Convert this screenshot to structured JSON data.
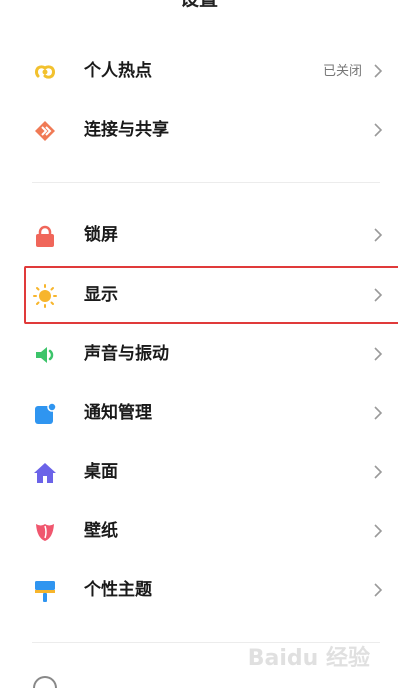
{
  "header": {
    "title": "设置"
  },
  "section1": {
    "items": [
      {
        "label": "个人热点",
        "status": "已关闭",
        "icon": "hotspot-icon",
        "color": "#f2c12e"
      },
      {
        "label": "连接与共享",
        "icon": "connection-share-icon",
        "color": "#f07a55"
      }
    ]
  },
  "section2": {
    "items": [
      {
        "label": "锁屏",
        "icon": "lock-icon",
        "color": "#f0665a"
      },
      {
        "label": "显示",
        "icon": "sun-icon",
        "color": "#f7b52c"
      },
      {
        "label": "声音与振动",
        "icon": "speaker-icon",
        "color": "#3cc46a"
      },
      {
        "label": "通知管理",
        "icon": "notification-icon",
        "color": "#2f95f0"
      },
      {
        "label": "桌面",
        "icon": "home-icon",
        "color": "#6b63e8"
      },
      {
        "label": "壁纸",
        "icon": "tulip-icon",
        "color": "#f0566e"
      },
      {
        "label": "个性主题",
        "icon": "theme-brush-icon",
        "color": "#2f95f0"
      }
    ]
  },
  "watermark": {
    "text": "Baidu 经验"
  }
}
